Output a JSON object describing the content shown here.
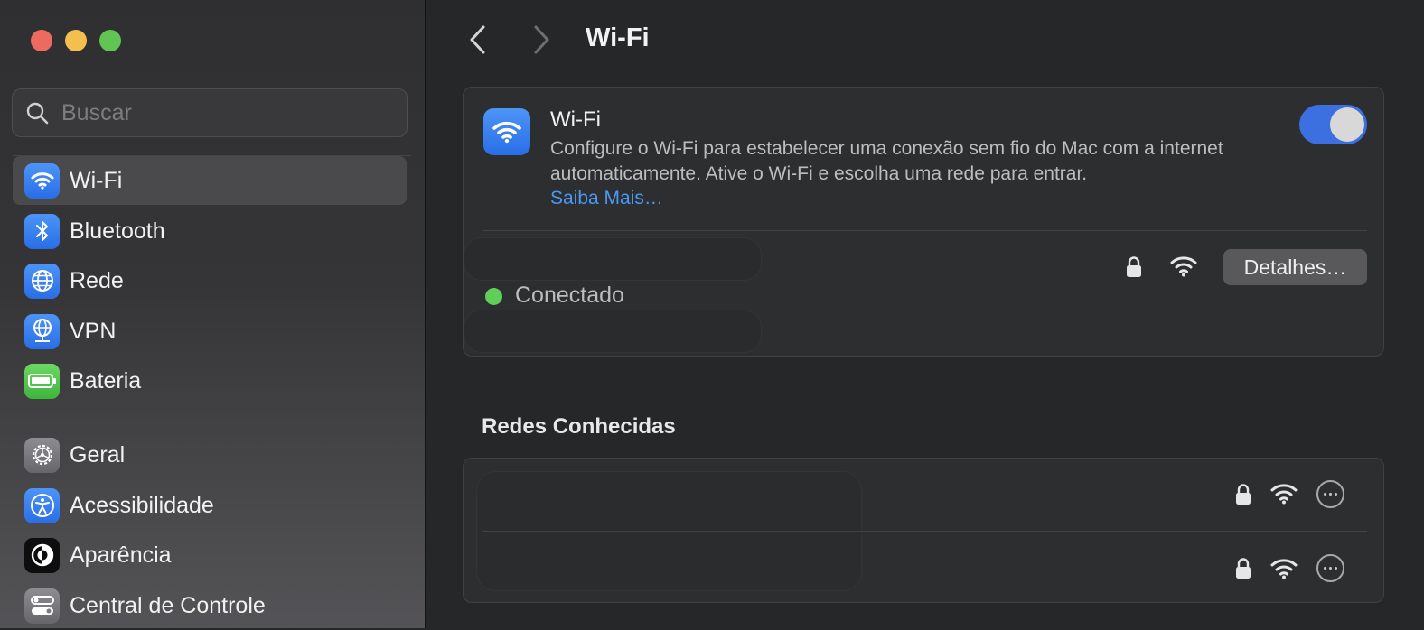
{
  "window": {
    "title": "Wi-Fi"
  },
  "search": {
    "placeholder": "Buscar"
  },
  "sidebar": {
    "items": [
      {
        "label": "Wi-Fi",
        "icon": "wifi-icon"
      },
      {
        "label": "Bluetooth",
        "icon": "bluetooth-icon"
      },
      {
        "label": "Rede",
        "icon": "globe-icon"
      },
      {
        "label": "VPN",
        "icon": "vpn-globe-icon"
      },
      {
        "label": "Bateria",
        "icon": "battery-icon"
      },
      {
        "label": "Geral",
        "icon": "gear-icon"
      },
      {
        "label": "Acessibilidade",
        "icon": "accessibility-icon"
      },
      {
        "label": "Aparência",
        "icon": "appearance-icon"
      },
      {
        "label": "Central de Controle",
        "icon": "control-center-icon"
      }
    ]
  },
  "wifi": {
    "heading": "Wi-Fi",
    "description": "Configure o Wi-Fi para estabelecer uma conexão sem fio do Mac com a internet automaticamente. Ative o Wi-Fi e escolha uma rede para entrar.",
    "learn_more": "Saiba Mais…",
    "enabled": true,
    "status": "Conectado",
    "details_label": "Detalhes…"
  },
  "known_networks": {
    "title": "Redes Conhecidas",
    "count": 2
  },
  "colors": {
    "accent": "#3c6fe0",
    "link": "#4a9af4",
    "connected": "#5fcf5a"
  }
}
